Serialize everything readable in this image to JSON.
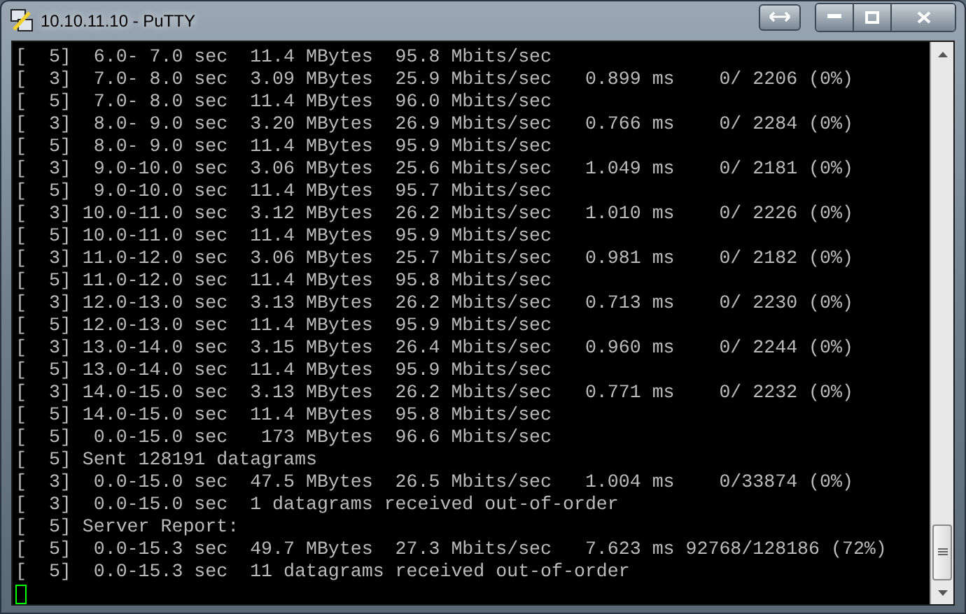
{
  "window": {
    "title": "10.10.11.10 - PuTTY"
  },
  "terminal": {
    "lines": [
      "[  5]  6.0- 7.0 sec  11.4 MBytes  95.8 Mbits/sec",
      "[  3]  7.0- 8.0 sec  3.09 MBytes  25.9 Mbits/sec   0.899 ms    0/ 2206 (0%)",
      "[  5]  7.0- 8.0 sec  11.4 MBytes  96.0 Mbits/sec",
      "[  3]  8.0- 9.0 sec  3.20 MBytes  26.9 Mbits/sec   0.766 ms    0/ 2284 (0%)",
      "[  5]  8.0- 9.0 sec  11.4 MBytes  95.9 Mbits/sec",
      "[  3]  9.0-10.0 sec  3.06 MBytes  25.6 Mbits/sec   1.049 ms    0/ 2181 (0%)",
      "[  5]  9.0-10.0 sec  11.4 MBytes  95.7 Mbits/sec",
      "[  3] 10.0-11.0 sec  3.12 MBytes  26.2 Mbits/sec   1.010 ms    0/ 2226 (0%)",
      "[  5] 10.0-11.0 sec  11.4 MBytes  95.9 Mbits/sec",
      "[  3] 11.0-12.0 sec  3.06 MBytes  25.7 Mbits/sec   0.981 ms    0/ 2182 (0%)",
      "[  5] 11.0-12.0 sec  11.4 MBytes  95.8 Mbits/sec",
      "[  3] 12.0-13.0 sec  3.13 MBytes  26.2 Mbits/sec   0.713 ms    0/ 2230 (0%)",
      "[  5] 12.0-13.0 sec  11.4 MBytes  95.9 Mbits/sec",
      "[  3] 13.0-14.0 sec  3.15 MBytes  26.4 Mbits/sec   0.960 ms    0/ 2244 (0%)",
      "[  5] 13.0-14.0 sec  11.4 MBytes  95.9 Mbits/sec",
      "[  3] 14.0-15.0 sec  3.13 MBytes  26.2 Mbits/sec   0.771 ms    0/ 2232 (0%)",
      "[  5] 14.0-15.0 sec  11.4 MBytes  95.8 Mbits/sec",
      "[  5]  0.0-15.0 sec   173 MBytes  96.6 Mbits/sec",
      "[  5] Sent 128191 datagrams",
      "[  3]  0.0-15.0 sec  47.5 MBytes  26.5 Mbits/sec   1.004 ms    0/33874 (0%)",
      "[  3]  0.0-15.0 sec  1 datagrams received out-of-order",
      "[  5] Server Report:",
      "[  5]  0.0-15.3 sec  49.7 MBytes  27.3 Mbits/sec   7.623 ms 92768/128186 (72%)",
      "[  5]  0.0-15.3 sec  11 datagrams received out-of-order"
    ],
    "cursor": {
      "visible": true
    }
  }
}
